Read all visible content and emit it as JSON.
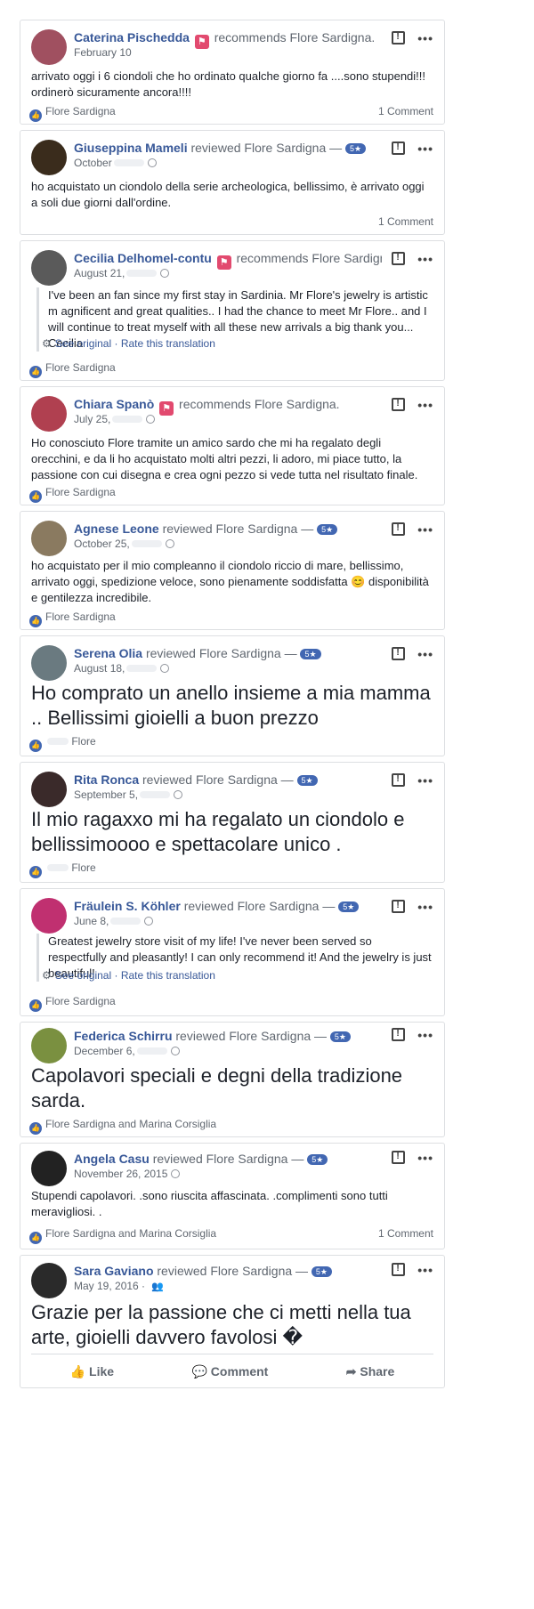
{
  "icons": {
    "report": "report-icon",
    "more": "more-dots-icon",
    "like": "like-thumb-icon",
    "recommend": "recommend-flag-icon",
    "globe": "globe-icon",
    "friends": "friends-icon",
    "gear": "gear-icon",
    "comment": "comment-icon",
    "share": "share-icon"
  },
  "colors": {
    "link": "#385898",
    "meta": "#606770",
    "like_blue": "#4267b2",
    "recommend": "#e24a6f"
  },
  "reviews": [
    {
      "author": "Caterina Pischedda",
      "verb": "recommends",
      "page": "Flore Sardigna.",
      "date": "February 10",
      "text": "arrivato oggi i 6 ciondoli che ho ordinato qualche giorno fa ....sono stupendi!!! ordinerò sicuramente ancora!!!!",
      "likes": "Flore Sardigna",
      "comments": "1 Comment"
    },
    {
      "author": "Giuseppina Mameli",
      "verb": "reviewed",
      "page": "Flore Sardigna —",
      "rating": "5★",
      "date": "October",
      "text": "ho acquistato un ciondolo della serie archeologica, bellissimo, è arrivato oggi a soli due giorni dall'ordine.",
      "comments": "1 Comment"
    },
    {
      "author": "Cecilia Delhomel-contu",
      "verb": "recommends",
      "page": "Flore Sardigna.",
      "date": "August 21,",
      "text": "I've been an fan since my first stay in Sardinia. Mr Flore's jewelry is artistic m agnificent and great qualities.. I had the chance to meet Mr Flore.. and I will continue to treat myself with all these new arrivals a big thank you... Cecilia",
      "see_original": "See original",
      "rate_translation": "Rate this translation",
      "likes": "Flore Sardigna"
    },
    {
      "author": "Chiara Spanò",
      "verb": "recommends",
      "page": "Flore Sardigna.",
      "date": "July 25,",
      "text": "Ho conosciuto Flore tramite un amico sardo che mi ha regalato degli orecchini, e da li ho acquistato molti altri pezzi, li adoro, mi piace tutto, la passione con cui disegna e crea ogni pezzo si vede tutta nel risultato finale.",
      "likes": "Flore Sardigna"
    },
    {
      "author": "Agnese Leone",
      "verb": "reviewed",
      "page": "Flore Sardigna —",
      "rating": "5★",
      "date": "October 25,",
      "text": "ho acquistato per il mio compleanno il ciondolo riccio di mare, bellissimo, arrivato oggi, spedizione veloce, sono pienamente soddisfatta 😊 disponibilità e gentilezza incredibile.",
      "likes": "Flore Sardigna"
    },
    {
      "author": "Serena Olia",
      "verb": "reviewed",
      "page": "Flore Sardigna —",
      "rating": "5★",
      "date": "August 18,",
      "text": "Ho comprato un anello insieme a mia mamma .. Bellissimi gioielli a buon prezzo",
      "likes": "Flore"
    },
    {
      "author": "Rita Ronca",
      "verb": "reviewed",
      "page": "Flore Sardigna —",
      "rating": "5★",
      "date": "September 5,",
      "text": "Il mio ragaxxo mi ha regalato un ciondolo e bellissimoooo e spettacolare unico .",
      "likes": "Flore"
    },
    {
      "author": "Fräulein S. Köhler",
      "verb": "reviewed",
      "page": "Flore Sardigna —",
      "rating": "5★",
      "date": "June 8,",
      "text": "Greatest jewelry store visit of my life! I've never been served so respectfully and pleasantly! I can only recommend it! And the jewelry is just beautiful!",
      "see_original": "See original",
      "rate_translation": "Rate this translation",
      "likes": "Flore Sardigna"
    },
    {
      "author": "Federica Schirru",
      "verb": "reviewed",
      "page": "Flore Sardigna —",
      "rating": "5★",
      "date": "December 6,",
      "text": "Capolavori speciali e degni della tradizione sarda.",
      "likes": "Flore Sardigna and Marina Corsiglia"
    },
    {
      "author": "Angela Casu",
      "verb": "reviewed",
      "page": "Flore Sardigna —",
      "rating": "5★",
      "date": "November 26, 2015",
      "text": "Stupendi capolavori. .sono riuscita affascinata. .complimenti sono tutti meravigliosi. .",
      "likes": "Flore Sardigna and Marina Corsiglia",
      "comments": "1 Comment"
    },
    {
      "author": "Sara Gaviano",
      "verb": "reviewed",
      "page": "Flore Sardigna —",
      "rating": "5★",
      "date": "May 19, 2016",
      "text": "Grazie per la passione che ci metti nella tua arte, gioielli davvero favolosi �"
    }
  ],
  "actions": {
    "like": "Like",
    "comment": "Comment",
    "share": "Share"
  }
}
